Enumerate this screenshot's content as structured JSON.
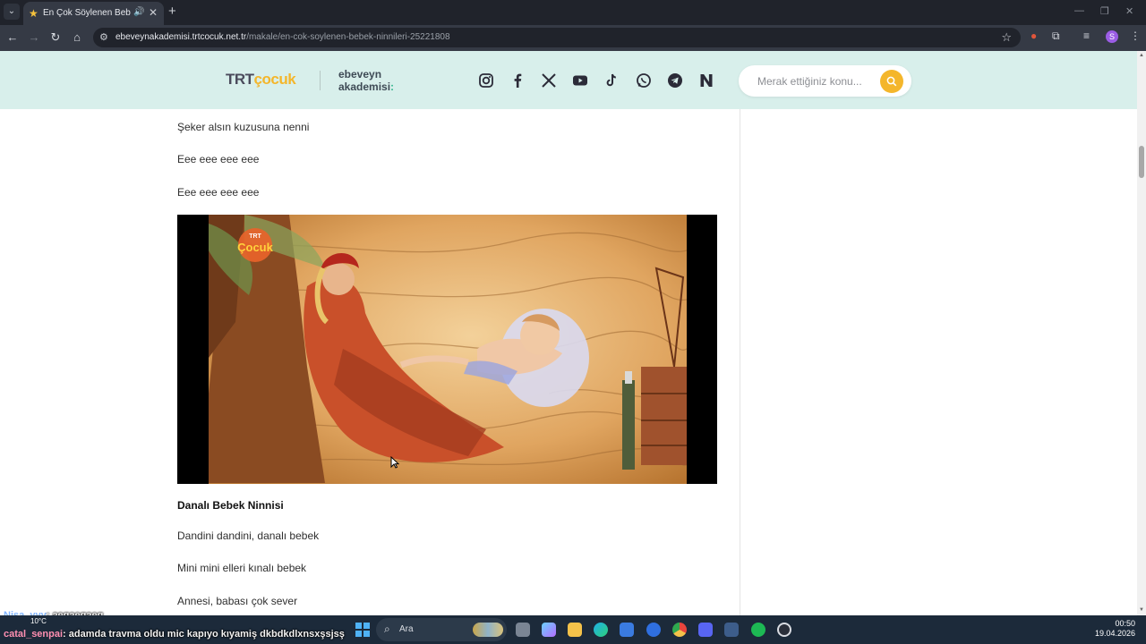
{
  "browser": {
    "tab": {
      "title": "En Çok Söylenen Bebek Ninnileri",
      "favicon": "star-icon"
    },
    "url_domain": "ebeveynakademisi.trtcocuk.net.tr",
    "url_path": "/makale/en-cok-soylenen-bebek-ninnileri-25221808",
    "profile_initial": "S"
  },
  "site": {
    "logo_trt": "TRT",
    "logo_cocuk": "çocuk",
    "logo_ea_line1": "ebeveyn",
    "logo_ea_line2": "akademisi",
    "social": [
      "instagram-icon",
      "facebook-icon",
      "x-icon",
      "youtube-icon",
      "tiktok-icon",
      "whatsapp-icon",
      "telegram-icon",
      "n-icon"
    ],
    "search_placeholder": "Merak ettiğiniz konu..."
  },
  "article": {
    "lines_top": [
      "Şeker alsın kuzusuna nenni",
      "Eee eee eee eee",
      "Eee eee eee eee"
    ],
    "video_logo_top": "TRT",
    "video_logo": "Çocuk",
    "section_title": "Danalı Bebek Ninnisi",
    "lines_bottom": [
      "Dandini dandini, danalı bebek",
      "Mini mini elleri kınalı bebek",
      "Annesi, babası çok sever"
    ]
  },
  "overlay_chat": [
    {
      "user": "Nisa_yyy",
      "message": ": aegaegaeg"
    },
    {
      "user": "catal_senpai",
      "message": ": adamda travma oldu mic kapıyo kıyamiş dkbdkdlxnsxşsjsş"
    }
  ],
  "taskbar": {
    "search_label": "Ara",
    "weather": "10°C",
    "time": "00:50",
    "date": "19.04.2026"
  }
}
